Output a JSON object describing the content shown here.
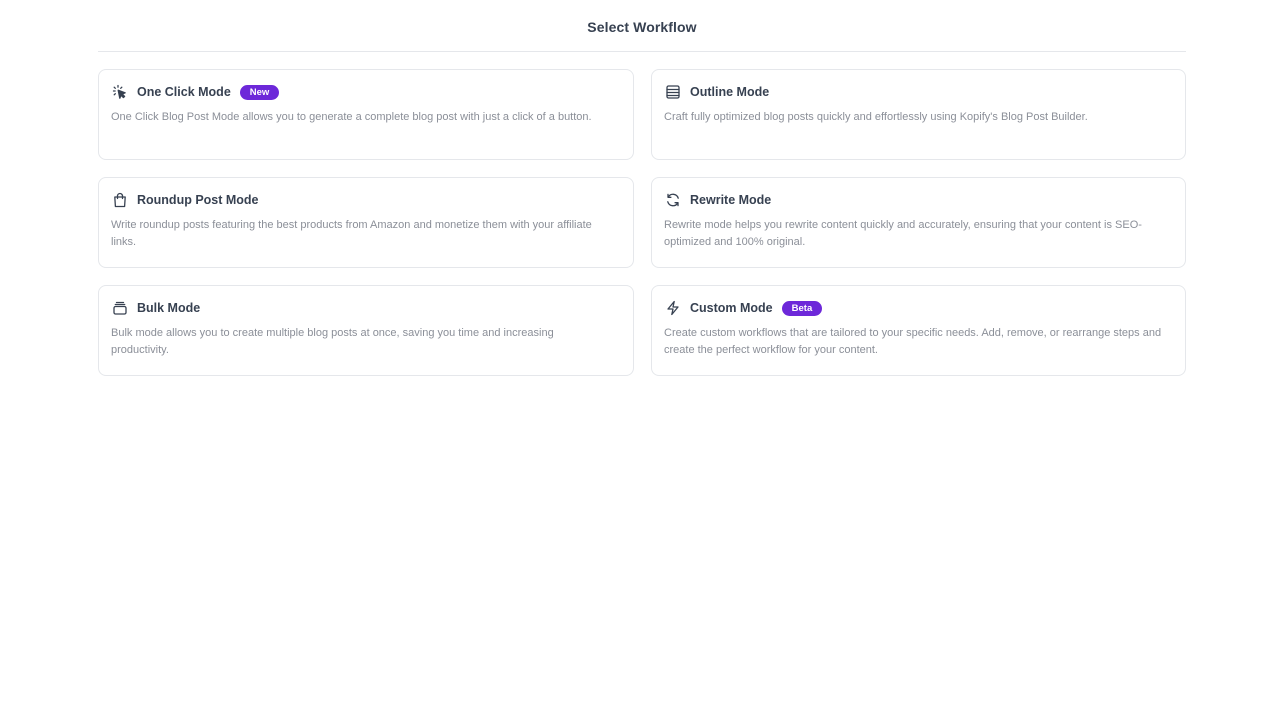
{
  "header": {
    "title": "Select Workflow"
  },
  "cards": [
    {
      "icon": "tap-click-icon",
      "title": "One Click Mode",
      "badge": "New",
      "description": "One Click Blog Post Mode allows you to generate a complete blog post with just a click of a button."
    },
    {
      "icon": "outline-list-icon",
      "title": "Outline Mode",
      "badge": "",
      "description": "Craft fully optimized blog posts quickly and effortlessly using Kopify's Blog Post Builder."
    },
    {
      "icon": "shopping-bag-icon",
      "title": "Roundup Post Mode",
      "badge": "",
      "description": "Write roundup posts featuring the best products from Amazon and monetize them with your affiliate links."
    },
    {
      "icon": "refresh-icon",
      "title": "Rewrite Mode",
      "badge": "",
      "description": "Rewrite mode helps you rewrite content quickly and accurately, ensuring that your content is SEO-optimized and 100% original."
    },
    {
      "icon": "stack-box-icon",
      "title": "Bulk Mode",
      "badge": "",
      "description": "Bulk mode allows you to create multiple blog posts at once, saving you time and increasing productivity."
    },
    {
      "icon": "lightning-icon",
      "title": "Custom Mode",
      "badge": "Beta",
      "description": "Create custom workflows that are tailored to your specific needs. Add, remove, or rearrange steps and create the perfect workflow for your content."
    }
  ],
  "colors": {
    "badge_bg": "#6d28d9",
    "border": "#e5e7eb",
    "title_text": "#374151",
    "description_text": "#8b8f98"
  }
}
